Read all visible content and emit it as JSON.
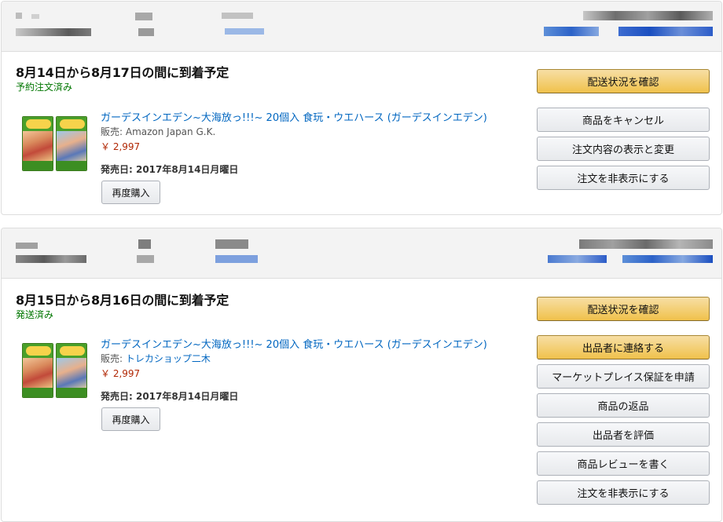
{
  "orders": [
    {
      "delivery_title": "8月14日から8月17日の間に到着予定",
      "status": "予約注文済み",
      "product": {
        "title": "ガーデスインエデン~大海放っ!!!~ 20個入 食玩・ウエハース (ガーデスインエデン)",
        "seller_prefix": "販売: ",
        "seller": "Amazon Japan G.K.",
        "price": "￥ 2,997",
        "release_label": "発売日: ",
        "release_date": "2017年8月14日月曜日",
        "rebuy_label": "再度購入"
      },
      "actions": [
        {
          "label": "配送状況を確認",
          "primary": true
        },
        {
          "label": "商品をキャンセル",
          "primary": false
        },
        {
          "label": "注文内容の表示と変更",
          "primary": false
        },
        {
          "label": "注文を非表示にする",
          "primary": false
        }
      ]
    },
    {
      "delivery_title": "8月15日から8月16日の間に到着予定",
      "status": "発送済み",
      "product": {
        "title": "ガーデスインエデン~大海放っ!!!~ 20個入 食玩・ウエハース (ガーデスインエデン)",
        "seller_prefix": "販売: ",
        "seller": "トレカショップ二木",
        "price": "￥ 2,997",
        "release_label": "発売日: ",
        "release_date": "2017年8月14日月曜日",
        "rebuy_label": "再度購入"
      },
      "actions": [
        {
          "label": "配送状況を確認",
          "primary": true
        },
        {
          "label": "出品者に連絡する",
          "primary": true
        },
        {
          "label": "マーケットプレイス保証を申請",
          "primary": false
        },
        {
          "label": "商品の返品",
          "primary": false
        },
        {
          "label": "出品者を評価",
          "primary": false
        },
        {
          "label": "商品レビューを書く",
          "primary": false
        },
        {
          "label": "注文を非表示にする",
          "primary": false
        }
      ]
    }
  ],
  "colors": {
    "link": "#0066c0",
    "price": "#b12704",
    "status": "#007600",
    "primary_button": "#f0c14b"
  }
}
